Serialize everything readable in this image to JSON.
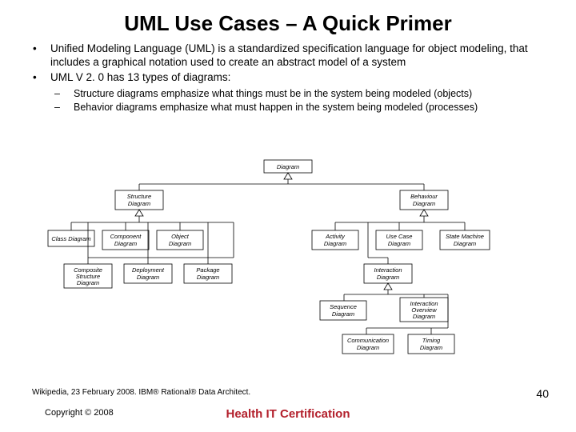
{
  "title": "UML Use Cases – A Quick Primer",
  "bullets": {
    "b1": "Unified Modeling Language (UML) is a standardized specification language for object modeling, that includes a graphical notation used to create an abstract model of a system",
    "b2": "UML V 2. 0 has 13 types of diagrams:"
  },
  "sub": {
    "s1": "Structure diagrams emphasize what things must be in the system being modeled (objects)",
    "s2": "Behavior diagrams emphasize what must happen in the system being modeled (processes)"
  },
  "diagram": {
    "root": "Diagram",
    "structure": {
      "label1": "Structure",
      "label2": "Diagram"
    },
    "behavior": {
      "label1": "Behaviour",
      "label2": "Diagram"
    },
    "class": "Class Diagram",
    "component": {
      "l1": "Component",
      "l2": "Diagram"
    },
    "object": {
      "l1": "Object",
      "l2": "Diagram"
    },
    "composite": {
      "l1": "Composite",
      "l2": "Structure",
      "l3": "Diagram"
    },
    "deployment": {
      "l1": "Deployment",
      "l2": "Diagram"
    },
    "package": {
      "l1": "Package",
      "l2": "Diagram"
    },
    "activity": {
      "l1": "Activity",
      "l2": "Diagram"
    },
    "usecase": {
      "l1": "Use Case",
      "l2": "Diagram"
    },
    "statemachine": {
      "l1": "State Machine",
      "l2": "Diagram"
    },
    "interaction": {
      "l1": "Interaction",
      "l2": "Diagram"
    },
    "sequence": {
      "l1": "Sequence",
      "l2": "Diagram"
    },
    "intoverview": {
      "l1": "Interaction",
      "l2": "Overview",
      "l3": "Diagram"
    },
    "communication": {
      "l1": "Communication",
      "l2": "Diagram"
    },
    "timing": {
      "l1": "Timing",
      "l2": "Diagram"
    }
  },
  "footer": {
    "cite": "Wikipedia, 23 February 2008. IBM® Rational® Data Architect.",
    "copyright": "Copyright © 2008",
    "center": "Health IT Certification",
    "page": "40"
  }
}
